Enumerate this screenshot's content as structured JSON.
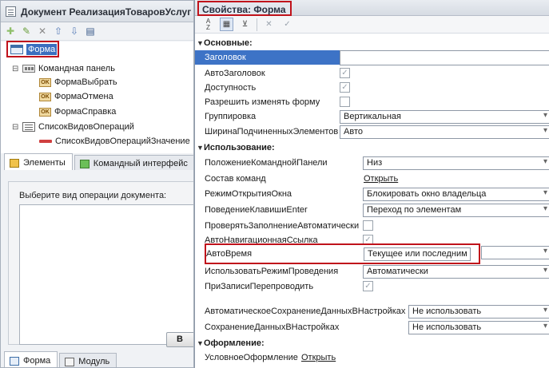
{
  "left_window": {
    "title": "Документ РеализацияТоваровУслуг",
    "toolbar_icons": [
      "add-icon",
      "edit-icon",
      "delete-icon",
      "move-up-icon",
      "move-down-icon",
      "properties-icon"
    ],
    "tree": {
      "root": "Форма",
      "command_panel": "Командная панель",
      "buttons": [
        "ФормаВыбрать",
        "ФормаОтмена",
        "ФормаСправка"
      ],
      "list": "СписокВидовОпераций",
      "list_field": "СписокВидовОперацийЗначение"
    },
    "tabs": [
      "Элементы",
      "Командный интерфейс"
    ],
    "preview_hint": "Выберите вид операции документа:",
    "preview_button": "В",
    "bottom_tabs": [
      "Форма",
      "Модуль"
    ]
  },
  "right_window": {
    "title": "Свойства: Форма",
    "toolbar_icons": [
      "sort-alpha-icon",
      "categories-icon",
      "filter-icon",
      "clear-icon",
      "check-icon"
    ],
    "groups": {
      "main": "Основные:",
      "usage": "Использование:",
      "appearance": "Оформление:"
    },
    "props": {
      "title": {
        "name": "Заголовок",
        "value": ""
      },
      "autotitle": {
        "name": "АвтоЗаголовок",
        "checked": true
      },
      "enabled": {
        "name": "Доступность",
        "checked": true
      },
      "allow_change": {
        "name": "Разрешить изменять форму",
        "checked": false
      },
      "grouping": {
        "name": "Группировка",
        "value": "Вертикальная"
      },
      "child_width": {
        "name": "ШиринаПодчиненныхЭлементов",
        "value": "Авто"
      },
      "cmd_panel_pos": {
        "name": "ПоложениеКоманднойПанели",
        "value": "Низ"
      },
      "cmd_composition": {
        "name": "Состав команд",
        "link": "Открыть"
      },
      "window_mode": {
        "name": "РежимОткрытияОкна",
        "value": "Блокировать окно владельца"
      },
      "enter_behavior": {
        "name": "ПоведениеКлавишиEnter",
        "value": "Переход по элементам"
      },
      "auto_check": {
        "name": "ПроверятьЗаполнениеАвтоматически",
        "checked": false
      },
      "auto_nav_link": {
        "name": "АвтоНавигационнаяСсылка",
        "checked": true
      },
      "auto_time": {
        "name": "АвтоВремя",
        "value": "Текущее или последним"
      },
      "posting_mode": {
        "name": "ИспользоватьРежимПроведения",
        "value": "Автоматически"
      },
      "repost_on_write": {
        "name": "ПриЗаписиПерепроводить",
        "checked": true
      },
      "auto_save_settings": {
        "name": "АвтоматическоеСохранениеДанныхВНастройках",
        "value": "Не использовать"
      },
      "save_settings": {
        "name": "СохранениеДанныхВНастройках",
        "value": "Не использовать"
      },
      "conditional_appearance": {
        "name": "УсловноеОформление",
        "link": "Открыть"
      }
    }
  }
}
